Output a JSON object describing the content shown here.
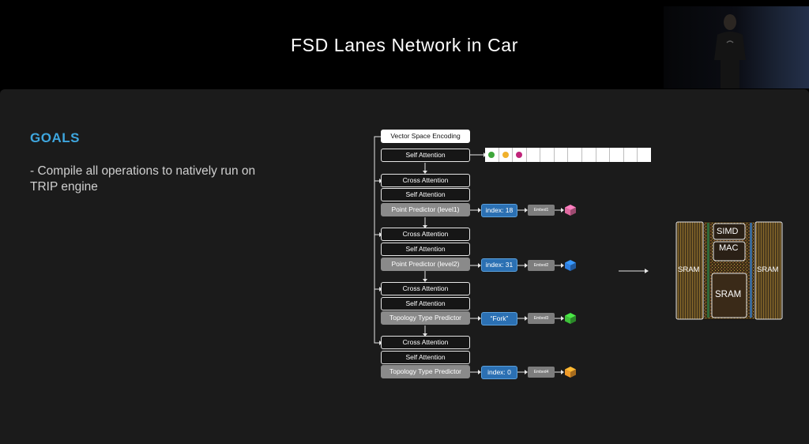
{
  "slide": {
    "title": "FSD Lanes Network in Car",
    "goals_heading": "GOALS",
    "goals_bullet": "- Compile all operations to natively run on TRIP engine"
  },
  "diagram": {
    "vector_space_encoding": "Vector Space Encoding",
    "self_attention": "Self Attention",
    "cross_attention": "Cross Attention",
    "point_predictor_l1": "Point Predictor (level1)",
    "point_predictor_l2": "Point Predictor (level2)",
    "topology_type_predictor": "Topology Type Predictor",
    "index_1": "index: 18",
    "index_2": "index: 31",
    "fork": "“Fork”",
    "index_4": "index: 0",
    "embed1": "Embed1",
    "embed2": "Embed2",
    "embed3": "Embed3",
    "embed4": "Embed4",
    "token_colors": [
      "#3ea63a",
      "#f0b12c",
      "#c0247a"
    ],
    "cube_colors": [
      "#e06aa0",
      "#2e7fe0",
      "#3ec23a",
      "#ef9a2a"
    ]
  },
  "chip": {
    "sram_left": "SRAM",
    "sram_right": "SRAM",
    "simd": "SIMD",
    "mac": "MAC",
    "sram_center": "SRAM"
  }
}
